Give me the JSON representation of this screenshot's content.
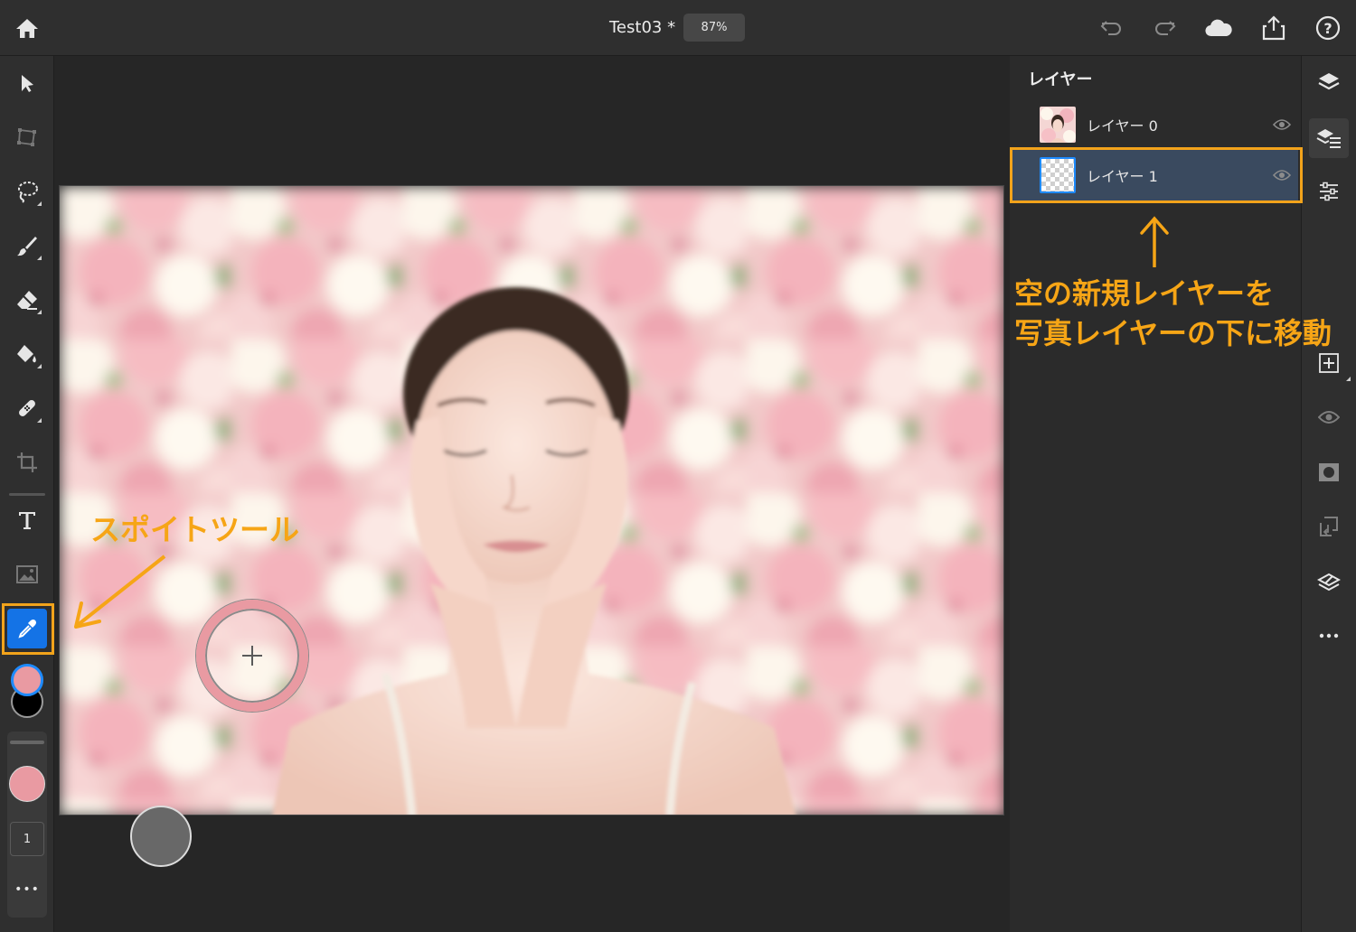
{
  "topbar": {
    "title": "Test03 *",
    "zoom": "87%",
    "icons": [
      "home-icon",
      "undo-icon",
      "redo-icon",
      "cloud-icon",
      "share-icon",
      "help-icon"
    ]
  },
  "toolbar": {
    "tools": [
      "select-tool",
      "transform-tool",
      "lasso-tool",
      "brush-tool",
      "eraser-tool",
      "fill-tool",
      "healing-tool",
      "crop-tool",
      "type-tool",
      "place-image-tool",
      "eyedropper-tool"
    ],
    "foreground_color": "#e99aa2",
    "background_color": "#000000",
    "brush_color": "#e99aa2",
    "brush_size": "1",
    "more": "•••"
  },
  "layers_panel": {
    "title": "レイヤー",
    "layers": [
      {
        "name": "レイヤー 0",
        "visible": true,
        "thumbnail": "photo"
      },
      {
        "name": "レイヤー 1",
        "visible": true,
        "thumbnail": "transparent",
        "selected": true
      }
    ]
  },
  "rail": {
    "icons": [
      "layers-icon",
      "layer-properties-icon",
      "adjustments-icon",
      "add-layer-icon",
      "visibility-icon",
      "mask-icon",
      "clip-layer-icon",
      "merge-icon",
      "more-icon"
    ]
  },
  "annotations": {
    "tool_label": "スポイトツール",
    "layer_note_line1": "空の新規レイヤーを",
    "layer_note_line2": "写真レイヤーの下に移動",
    "accent_color": "#f2a31b"
  },
  "colors": {
    "ui_dark": "#2f2f2f",
    "selected_layer": "#3a4a5f",
    "active_tool": "#1473e6"
  }
}
